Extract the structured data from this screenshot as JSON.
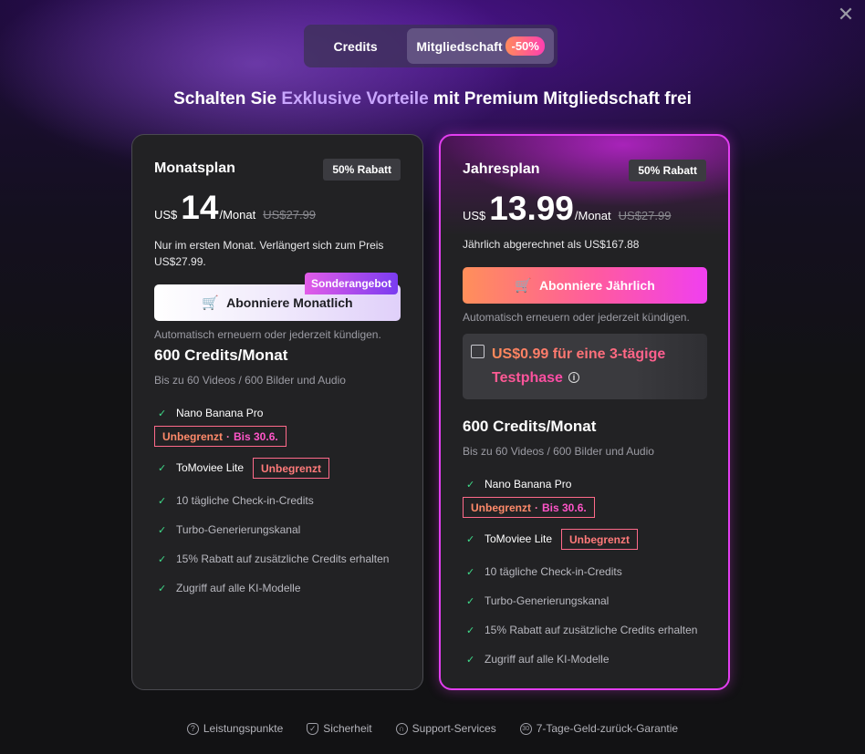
{
  "close_glyph": "✕",
  "tabs": [
    {
      "label": "Credits"
    },
    {
      "label": "Mitgliedschaft",
      "badge": "-50%"
    }
  ],
  "headline": {
    "pre": "Schalten Sie ",
    "highlight": "Exklusive Vorteile",
    "post": " mit Premium Mitgliedschaft frei"
  },
  "monthly": {
    "title": "Monatsplan",
    "discount": "50% Rabatt",
    "currency": "US$",
    "price": "14",
    "per": "/Monat",
    "old_price": "US$27.99",
    "note": "Nur im ersten Monat. Verlängert sich zum Preis US$27.99.",
    "special_badge": "Sonderangebot",
    "button": "Abonniere Monatlich",
    "auto_renew": "Automatisch erneuern oder jederzeit kündigen.",
    "credits_title": "600 Credits/Monat",
    "credits_sub": "Bis zu 60 Videos / 600 Bilder und Audio",
    "features": [
      "Nano Banana Pro",
      "ToMoviee Lite",
      "10 tägliche Check-in-Credits",
      "Turbo-Generierungskanal",
      "15% Rabatt auf zusätzliche Credits erhalten",
      "Zugriff auf alle KI-Modelle"
    ],
    "tag_unlimited_until": {
      "a": "Unbegrenzt",
      "sep": "·",
      "b": "Bis 30.6."
    },
    "tag_unlimited": "Unbegrenzt"
  },
  "yearly": {
    "title": "Jahresplan",
    "discount": "50% Rabatt",
    "currency": "US$",
    "price": "13.99",
    "per": "/Monat",
    "old_price": "US$27.99",
    "note": "Jährlich abgerechnet als US$167.88",
    "button": "Abonniere Jährlich",
    "auto_renew": "Automatisch erneuern oder jederzeit kündigen.",
    "trial_text": "US$0.99 für eine 3-tägige Testphase",
    "trial_info_glyph": "i",
    "credits_title": "600 Credits/Monat",
    "credits_sub": "Bis zu 60 Videos / 600 Bilder und Audio",
    "features": [
      "Nano Banana Pro",
      "ToMoviee Lite",
      "10 tägliche Check-in-Credits",
      "Turbo-Generierungskanal",
      "15% Rabatt auf zusätzliche Credits erhalten",
      "Zugriff auf alle KI-Modelle"
    ],
    "tag_unlimited_until": {
      "a": "Unbegrenzt",
      "sep": "·",
      "b": "Bis 30.6."
    },
    "tag_unlimited": "Unbegrenzt"
  },
  "footer": [
    {
      "label": "Leistungspunkte",
      "icon": "?"
    },
    {
      "label": "Sicherheit",
      "icon": "✓"
    },
    {
      "label": "Support-Services",
      "icon": "∩"
    },
    {
      "label": "7-Tage-Geld-zurück-Garantie",
      "icon": "30"
    }
  ],
  "colors": {
    "accent_purple": "#c9a6ff",
    "card_border_yearly": "#e23ef0",
    "check_green": "#3fdc8a",
    "tag_border": "#ff6a8a"
  }
}
